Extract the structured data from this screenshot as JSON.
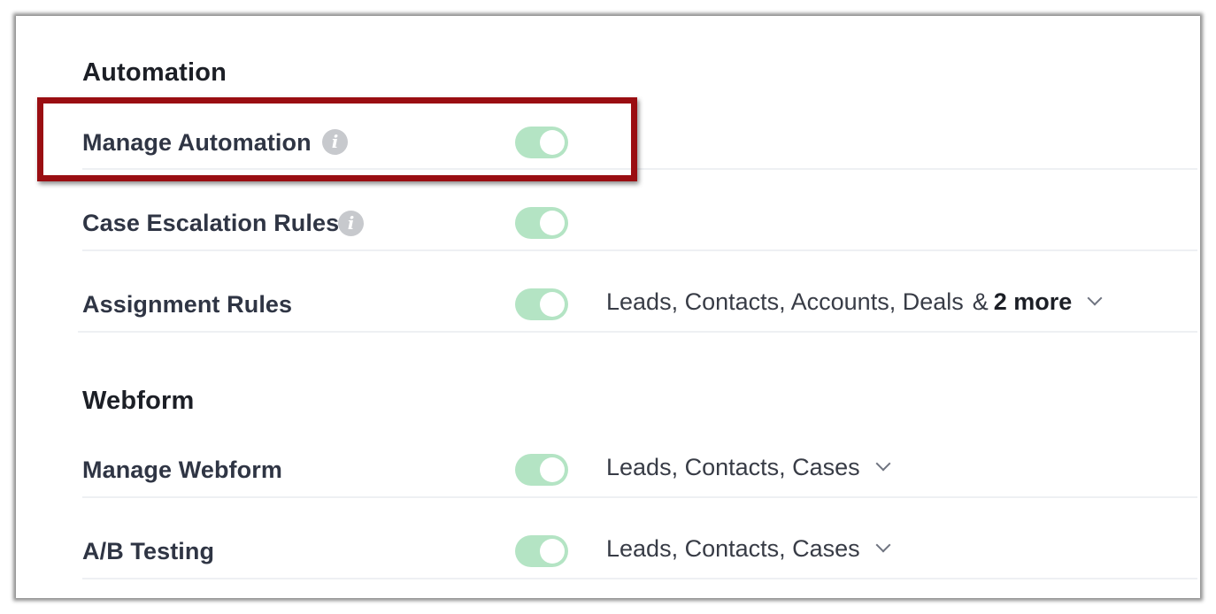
{
  "sections": [
    {
      "title": "Automation",
      "rows": [
        {
          "label": "Manage Automation",
          "info": "i",
          "toggle_on": true,
          "modules": ""
        },
        {
          "label": "Case Escalation Rules",
          "info": "i",
          "toggle_on": true,
          "modules": ""
        },
        {
          "label": "Assignment Rules",
          "toggle_on": true,
          "modules": "Leads, Contacts, Accounts, Deals",
          "amp": "&",
          "more": "2 more"
        }
      ]
    },
    {
      "title": "Webform",
      "rows": [
        {
          "label": "Manage Webform",
          "toggle_on": true,
          "modules": "Leads, Contacts, Cases"
        },
        {
          "label": "A/B Testing",
          "toggle_on": true,
          "modules": "Leads, Contacts, Cases"
        }
      ]
    }
  ],
  "colors": {
    "toggle_on": "#b4e4c4",
    "highlight_border": "#9a0e12",
    "label_text": "#2f3544"
  },
  "icons": {
    "info": "info-icon",
    "dropdown": "chevron-down-icon"
  }
}
